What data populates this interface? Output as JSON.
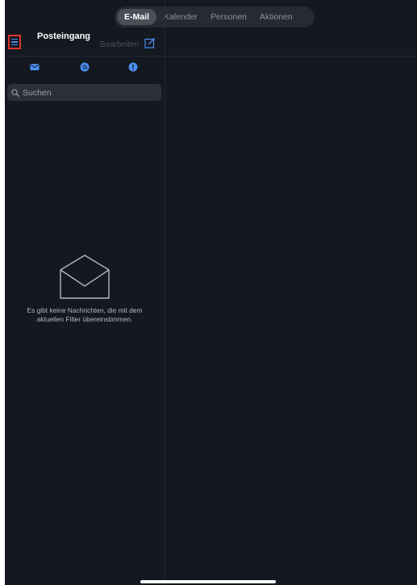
{
  "tabs": [
    {
      "label": "E-Mail",
      "active": true
    },
    {
      "label": "Kalender",
      "active": false
    },
    {
      "label": "Personen",
      "active": false
    },
    {
      "label": "Aktionen",
      "active": false
    }
  ],
  "mailbox": {
    "title": "Posteingang",
    "edit_label": "Bearbeiten",
    "compose_icon": "compose-icon",
    "menu_icon": "hamburger-menu-icon"
  },
  "filters": [
    {
      "icon": "mail-icon"
    },
    {
      "icon": "at-mention-icon"
    },
    {
      "icon": "exclamation-icon"
    }
  ],
  "search": {
    "placeholder": "Suchen",
    "value": ""
  },
  "empty_state": {
    "icon": "open-envelope-icon",
    "line1": "Es gibt keine Nachrichten, die mit dem",
    "line2": "aktuellen Filter übereinstimmen."
  },
  "colors": {
    "background": "#141820",
    "accent": "#4b8ff0",
    "highlight_border": "#e0322b"
  }
}
